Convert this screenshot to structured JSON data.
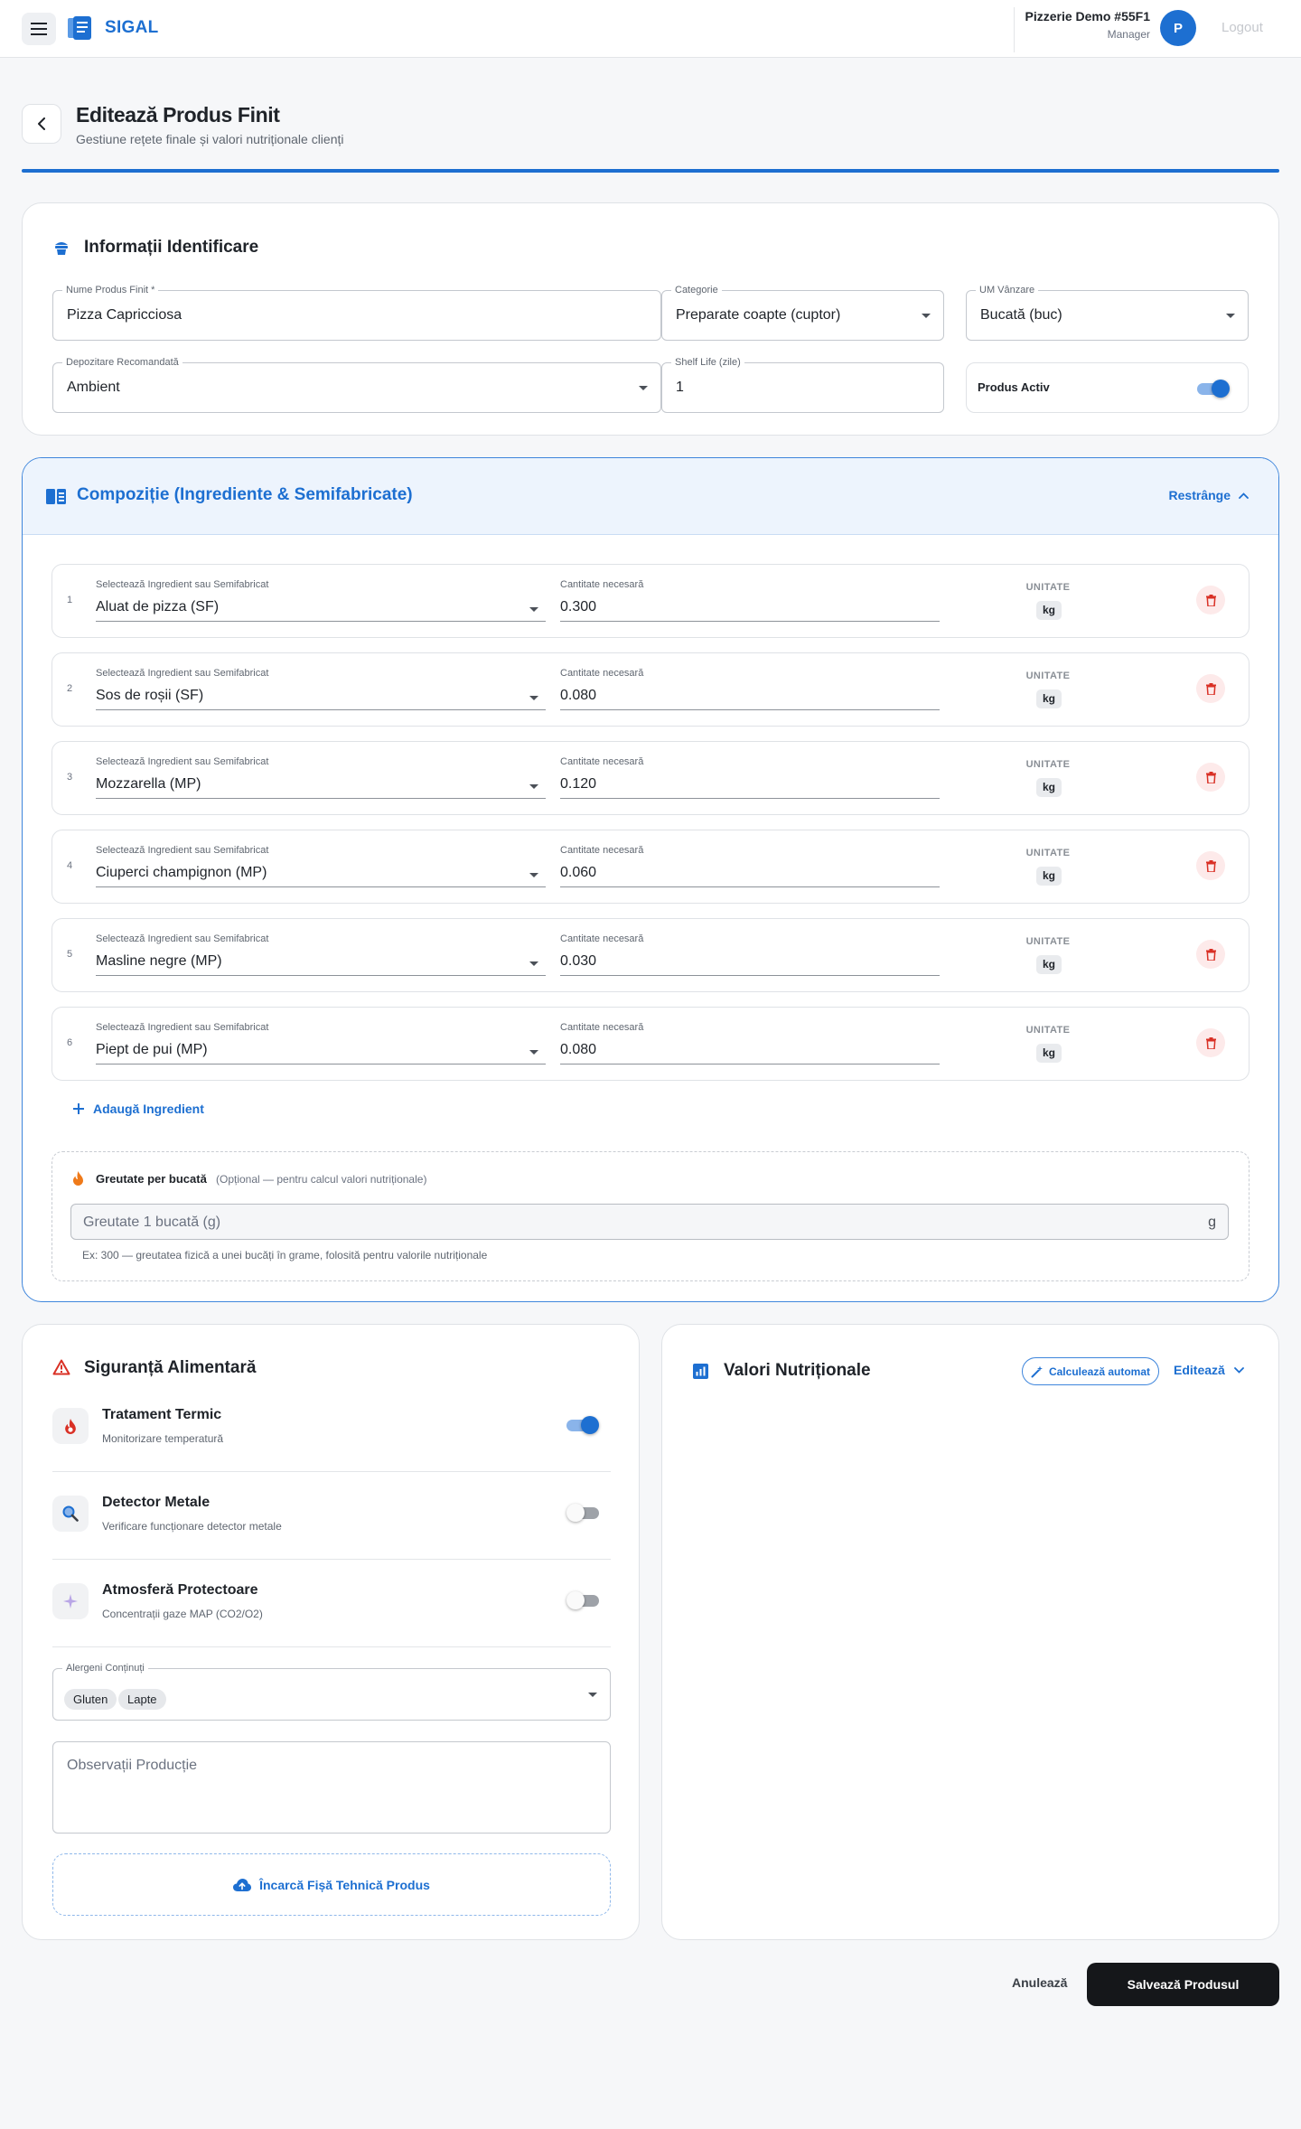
{
  "app": {
    "name": "SIGAL"
  },
  "header": {
    "tenant": "Pizzerie Demo #55F1",
    "role": "Manager",
    "avatar_letter": "P",
    "logout_label": "Logout"
  },
  "page": {
    "title": "Editează Produs Finit",
    "subtitle": "Gestiune rețete finale și valori nutriționale clienți"
  },
  "identification": {
    "title": "Informații Identificare",
    "name": {
      "label": "Nume Produs Finit *",
      "value": "Pizza Capricciosa"
    },
    "category": {
      "label": "Categorie",
      "value": "Preparate coapte (cuptor)"
    },
    "uom": {
      "label": "UM Vânzare",
      "value": "Bucată (buc)"
    },
    "storage": {
      "label": "Depozitare Recomandată",
      "value": "Ambient"
    },
    "shelf_life": {
      "label": "Shelf Life (zile)",
      "value": "1"
    },
    "active": {
      "label": "Produs Activ",
      "on": true
    }
  },
  "composition": {
    "title": "Compoziție (Ingrediente & Semifabricate)",
    "collapse_label": "Restrânge",
    "select_label": "Selectează Ingredient sau Semifabricat",
    "qty_label": "Cantitate necesară",
    "unit_label": "UNITATE",
    "rows": [
      {
        "index": "1",
        "ingredient": "Aluat de pizza (SF)",
        "qty": "0.300",
        "unit": "kg"
      },
      {
        "index": "2",
        "ingredient": "Sos de roșii (SF)",
        "qty": "0.080",
        "unit": "kg"
      },
      {
        "index": "3",
        "ingredient": "Mozzarella (MP)",
        "qty": "0.120",
        "unit": "kg"
      },
      {
        "index": "4",
        "ingredient": "Ciuperci champignon (MP)",
        "qty": "0.060",
        "unit": "kg"
      },
      {
        "index": "5",
        "ingredient": "Masline negre (MP)",
        "qty": "0.030",
        "unit": "kg"
      },
      {
        "index": "6",
        "ingredient": "Piept de pui (MP)",
        "qty": "0.080",
        "unit": "kg"
      }
    ],
    "add_label": "Adaugă Ingredient",
    "weight": {
      "title": "Greutate per bucată",
      "optional": "(Opțional — pentru calcul valori nutriționale)",
      "placeholder": "Greutate 1 bucată (g)",
      "suffix": "g",
      "hint": "Ex: 300 — greutatea fizică a unei bucăți în grame, folosită pentru valorile nutriționale"
    }
  },
  "safety": {
    "title": "Siguranță Alimentară",
    "items": [
      {
        "title": "Tratament Termic",
        "subtitle": "Monitorizare temperatură",
        "on": true,
        "icon": "flame-icon"
      },
      {
        "title": "Detector Metale",
        "subtitle": "Verificare funcționare detector metale",
        "on": false,
        "icon": "magnifier-icon"
      },
      {
        "title": "Atmosferă Protectoare",
        "subtitle": "Concentrații gaze MAP (CO2/O2)",
        "on": false,
        "icon": "sparkle-icon"
      }
    ],
    "allergens": {
      "label": "Alergeni Conținuți",
      "chips": [
        "Gluten",
        "Lapte"
      ]
    },
    "notes_placeholder": "Observații Producție",
    "upload_label": "Încarcă Fișă Tehnică Produs"
  },
  "nutrition": {
    "title": "Valori Nutriționale",
    "calc_label": "Calculează automat",
    "edit_label": "Editează"
  },
  "footer": {
    "cancel_label": "Anulează",
    "save_label": "Salvează Produsul"
  },
  "colors": {
    "primary": "#1d6fd1",
    "danger": "#d93025",
    "dark": "#15171a"
  }
}
